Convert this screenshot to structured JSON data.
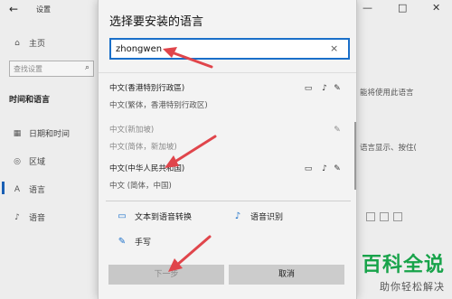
{
  "settings_window": {
    "title": "设置",
    "back": "←",
    "controls": [
      "—",
      "□",
      "✕"
    ],
    "sidebar": {
      "home": "主页",
      "search_placeholder": "查找设置",
      "heading": "时间和语言",
      "items": [
        "日期和时间",
        "区域",
        "语言",
        "语音"
      ]
    },
    "right_snippets": [
      "能将使用此语言",
      "语言显示、按住("
    ]
  },
  "dialog": {
    "title": "选择要安装的语言",
    "search_value": "zhongwen",
    "clear_icon": "×",
    "languages": [
      {
        "name": "中文(香港特別行政區)",
        "sub": "中文(繁体，香港特别行政区)",
        "features": [
          "display-icon",
          "mic-icon",
          "handwriting-icon"
        ],
        "dim": false
      },
      {
        "name": "中文(新加坡)",
        "sub": "中文(简体，新加坡)",
        "features": [
          "handwriting-icon"
        ],
        "dim": true
      },
      {
        "name": "中文(中华人民共和国)",
        "sub": "中文 (简体，中国)",
        "features": [
          "display-icon",
          "mic-icon",
          "handwriting-icon"
        ],
        "dim": false
      }
    ],
    "capabilities": {
      "tts": "文本到语音转换",
      "speech": "语音识别",
      "handwriting": "手写"
    },
    "buttons": {
      "next": "下一步",
      "cancel": "取消"
    }
  },
  "watermark": {
    "main": "百科全说",
    "sub": "助你轻松解决"
  },
  "colors": {
    "accent": "#1a6fc9",
    "annotation": "#e0454b",
    "watermark": "#18a34a"
  }
}
